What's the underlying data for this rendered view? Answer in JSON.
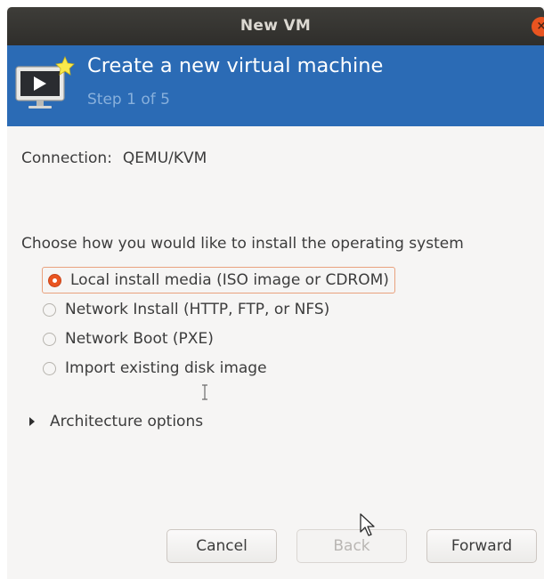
{
  "window": {
    "title": "New VM",
    "close_icon": "×"
  },
  "header": {
    "title": "Create a new virtual machine",
    "step": "Step 1 of 5",
    "icon": "vm-monitor-new-icon",
    "bg_color": "#2b6bb5"
  },
  "connection": {
    "label": "Connection:",
    "value": "QEMU/KVM"
  },
  "install": {
    "prompt": "Choose how you would like to install the operating system",
    "options": [
      {
        "label": "Local install media (ISO image or CDROM)",
        "checked": true
      },
      {
        "label": "Network Install (HTTP, FTP, or NFS)",
        "checked": false
      },
      {
        "label": "Network Boot (PXE)",
        "checked": false
      },
      {
        "label": "Import existing disk image",
        "checked": false
      }
    ]
  },
  "architecture": {
    "label": "Architecture options"
  },
  "buttons": {
    "cancel": "Cancel",
    "back": "Back",
    "forward": "Forward"
  },
  "accent_color": "#e95420"
}
